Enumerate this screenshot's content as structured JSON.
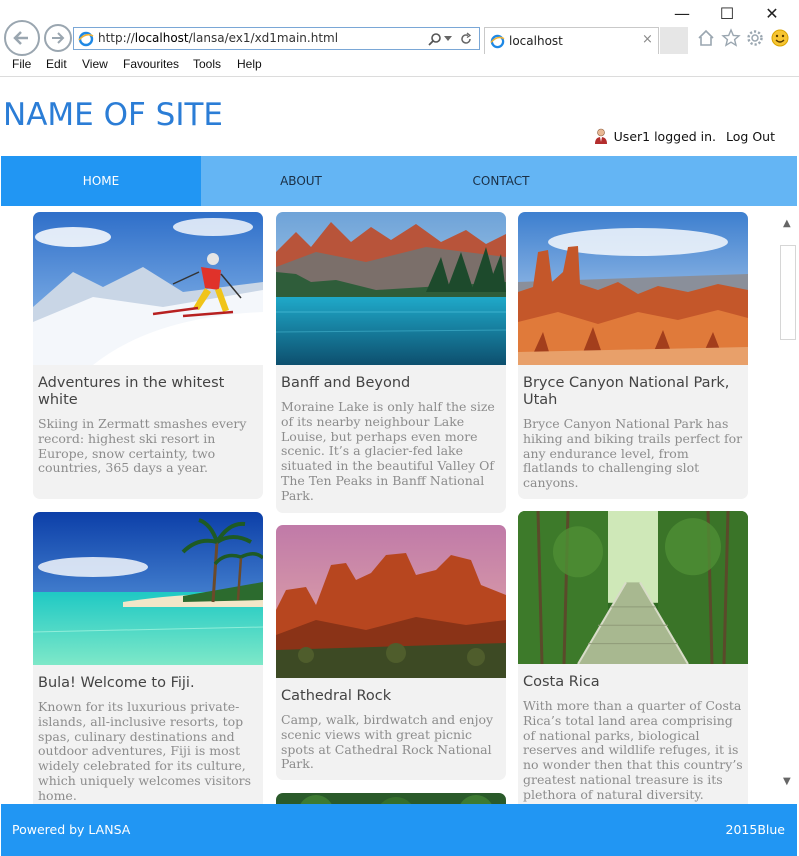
{
  "window": {
    "minimize": "—",
    "maximize": "☐",
    "close": "✕"
  },
  "browser": {
    "address": {
      "prefix": "http://",
      "host": "localhost",
      "path": "/lansa/ex1/xd1main.html"
    },
    "tab": {
      "title": "localhost",
      "close": "×"
    },
    "menu": [
      "File",
      "Edit",
      "View",
      "Favourites",
      "Tools",
      "Help"
    ],
    "icons": [
      "home-icon",
      "star-icon",
      "gear-icon",
      "smiley-icon"
    ]
  },
  "site": {
    "title": "NAME OF SITE",
    "user": {
      "text": "User1 logged in.",
      "logout": "Log Out"
    },
    "nav": [
      {
        "label": "HOME",
        "active": true
      },
      {
        "label": "ABOUT"
      },
      {
        "label": "CONTACT"
      }
    ],
    "cards": [
      {
        "title": "Adventures in the whitest white",
        "desc": "Skiing in Zermatt smashes every record: highest ski resort in Europe, snow certainty, two countries, 365 days a year.",
        "image": "skier-on-snow"
      },
      {
        "title": "Banff and Beyond",
        "desc": "Moraine Lake is only half the size of its nearby neighbour Lake Louise, but perhaps even more scenic. It’s a glacier-fed lake situated in the beautiful Valley Of The Ten Peaks in Banff National Park.",
        "image": "mountain-lake"
      },
      {
        "title": "Bryce Canyon National Park, Utah",
        "desc": "Bryce Canyon National Park has hiking and biking trails perfect for any endurance level, from flatlands to challenging slot canyons.",
        "image": "canyon-hoodoos"
      },
      {
        "title": "Bula! Welcome to Fiji.",
        "desc": "Known for its luxurious private-islands, all-inclusive resorts, top spas, culinary destinations and outdoor adventures, Fiji is most widely celebrated for its culture, which uniquely welcomes visitors home.",
        "image": "tropical-beach"
      },
      {
        "title": "Cathedral Rock",
        "desc": "Camp, walk, birdwatch and enjoy scenic views with great picnic spots at Cathedral Rock National Park.",
        "image": "red-rocks"
      },
      {
        "title": "Costa Rica",
        "desc": "With more than a quarter of Costa Rica’s total land area comprising of national parks, biological reserves and wildlife refuges, it is no wonder then that this country’s greatest national treasure is its plethora of natural diversity.",
        "image": "jungle-bridge"
      }
    ],
    "footer": {
      "left": "Powered by LANSA",
      "right": "2015Blue"
    }
  },
  "colors": {
    "accent": "#2196f3",
    "nav_bg": "#64b5f4",
    "title": "#2b7dd6",
    "card_bg": "#f2f2f2"
  }
}
